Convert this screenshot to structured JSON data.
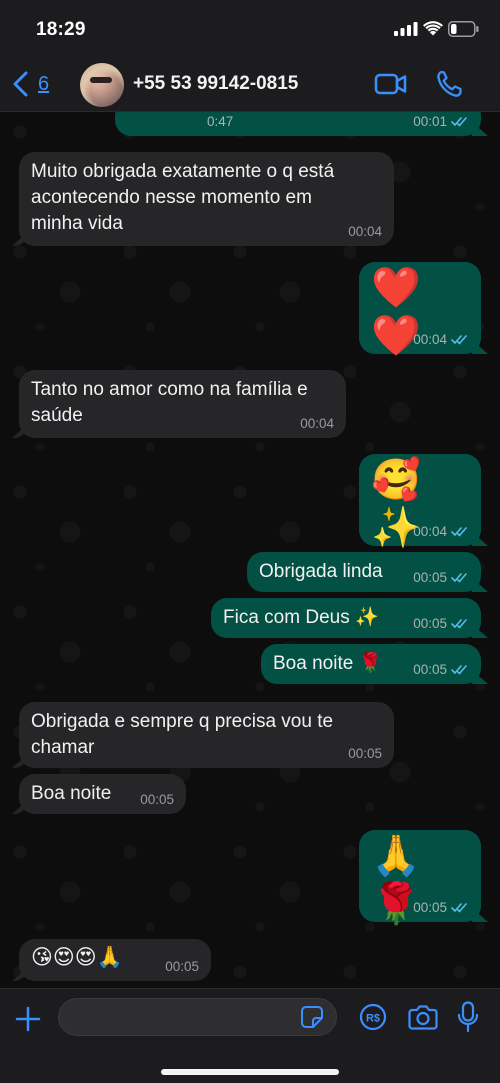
{
  "status": {
    "time": "18:29"
  },
  "header": {
    "back_count": "6",
    "contact": "+55 53 99142-0815"
  },
  "messages": [
    {
      "dir": "out",
      "partial": true,
      "duration": "0:47",
      "time": "00:01"
    },
    {
      "dir": "in",
      "text": "Muito obrigada exatamente o q está acontecendo  nesse momento em minha vida",
      "time": "00:04"
    },
    {
      "dir": "out",
      "text": "❤️❤️",
      "time": "00:04"
    },
    {
      "dir": "in",
      "text": "Tanto no amor como na família e saúde",
      "time": "00:04"
    },
    {
      "dir": "out",
      "text": "🥰✨",
      "time": "00:04"
    },
    {
      "dir": "out",
      "text": "Obrigada linda",
      "time": "00:05"
    },
    {
      "dir": "out",
      "text": "Fica com Deus ✨",
      "time": "00:05"
    },
    {
      "dir": "out",
      "text": "Boa noite 🌹",
      "time": "00:05"
    },
    {
      "dir": "in",
      "text": "Obrigada e sempre q precisa vou te chamar",
      "time": "00:05"
    },
    {
      "dir": "in",
      "text": "Boa noite",
      "time": "00:05"
    },
    {
      "dir": "out",
      "text": "🙏🌹",
      "time": "00:05"
    },
    {
      "dir": "in",
      "text": "😘😍😍🙏",
      "time": "00:05"
    }
  ],
  "input": {
    "value": "",
    "placeholder": ""
  },
  "colors": {
    "accent": "#3a8fff",
    "outgoing": "#025144",
    "incoming": "#262628",
    "tick_read": "#53bdeb"
  },
  "icons": [
    "back-chevron-icon",
    "video-call-icon",
    "phone-icon",
    "plus-icon",
    "sticker-icon",
    "payment-icon",
    "camera-icon",
    "mic-icon"
  ]
}
